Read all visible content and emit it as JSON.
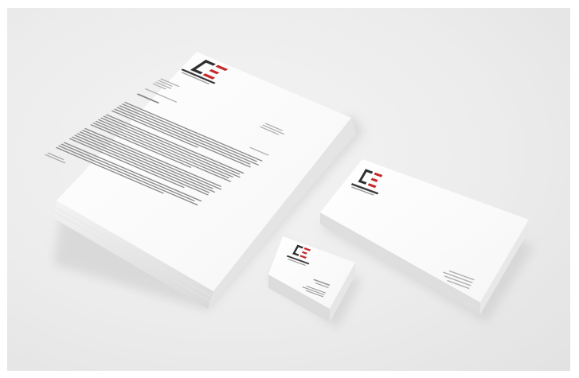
{
  "brand": {
    "name": "",
    "tagline": "",
    "colors": {
      "primary": "#2e2e2e",
      "accent": "#c62828"
    }
  },
  "icons": [
    "logo-mark-icon"
  ]
}
